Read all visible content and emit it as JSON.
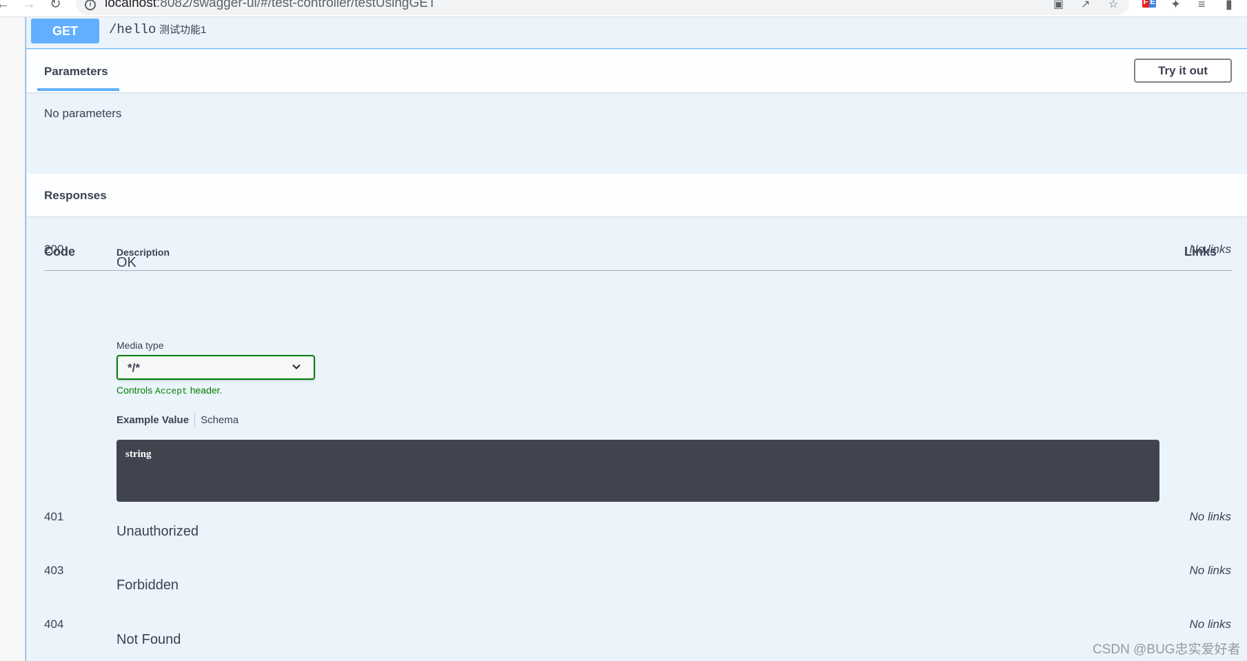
{
  "browser": {
    "url_host": "localhost",
    "url_rest": ":8082/swagger-ui/#/test-controller/testUsingGET",
    "icons": [
      "back-icon",
      "forward-icon",
      "reload-icon",
      "site-info-icon",
      "translate-icon",
      "share-icon",
      "bookmark-star-icon",
      "fe-extension-icon",
      "extensions-puzzle-icon",
      "reading-list-icon",
      "side-panel-icon"
    ]
  },
  "operation": {
    "method": "GET",
    "path": "/hello",
    "summary": "测试功能1",
    "method_color": "#61affe"
  },
  "parameters": {
    "tab_label": "Parameters",
    "try_it_out_label": "Try it out",
    "empty_text": "No parameters"
  },
  "responses": {
    "title": "Responses",
    "headers": {
      "code": "Code",
      "description": "Description",
      "links": "Links"
    },
    "media_type_label": "Media type",
    "media_type_value": "*/*",
    "media_hint_prefix": "Controls ",
    "media_hint_code": "Accept",
    "media_hint_suffix": " header.",
    "example_tab": "Example Value",
    "schema_tab": "Schema",
    "example_code": "string",
    "rows": [
      {
        "code": "200",
        "description": "OK",
        "links": "No links"
      },
      {
        "code": "401",
        "description": "Unauthorized",
        "links": "No links"
      },
      {
        "code": "403",
        "description": "Forbidden",
        "links": "No links"
      },
      {
        "code": "404",
        "description": "Not Found",
        "links": "No links"
      }
    ]
  },
  "watermark": "CSDN @BUG忠实爱好者"
}
